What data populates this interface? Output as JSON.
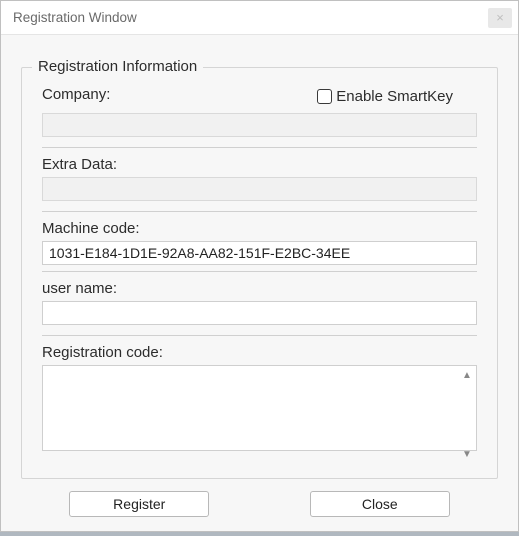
{
  "window": {
    "title": "Registration Window"
  },
  "group": {
    "title": "Registration Information",
    "company_label": "Company:",
    "company_value": "",
    "smartkey_label": "Enable SmartKey",
    "smartkey_checked": false,
    "extra_data_label": "Extra Data:",
    "extra_data_value": "",
    "machine_code_label": "Machine code:",
    "machine_code_value": "1031-E184-1D1E-92A8-AA82-151F-E2BC-34EE",
    "user_name_label": "user name:",
    "user_name_value": "",
    "registration_code_label": "Registration code:",
    "registration_code_value": ""
  },
  "buttons": {
    "register": "Register",
    "close": "Close"
  }
}
